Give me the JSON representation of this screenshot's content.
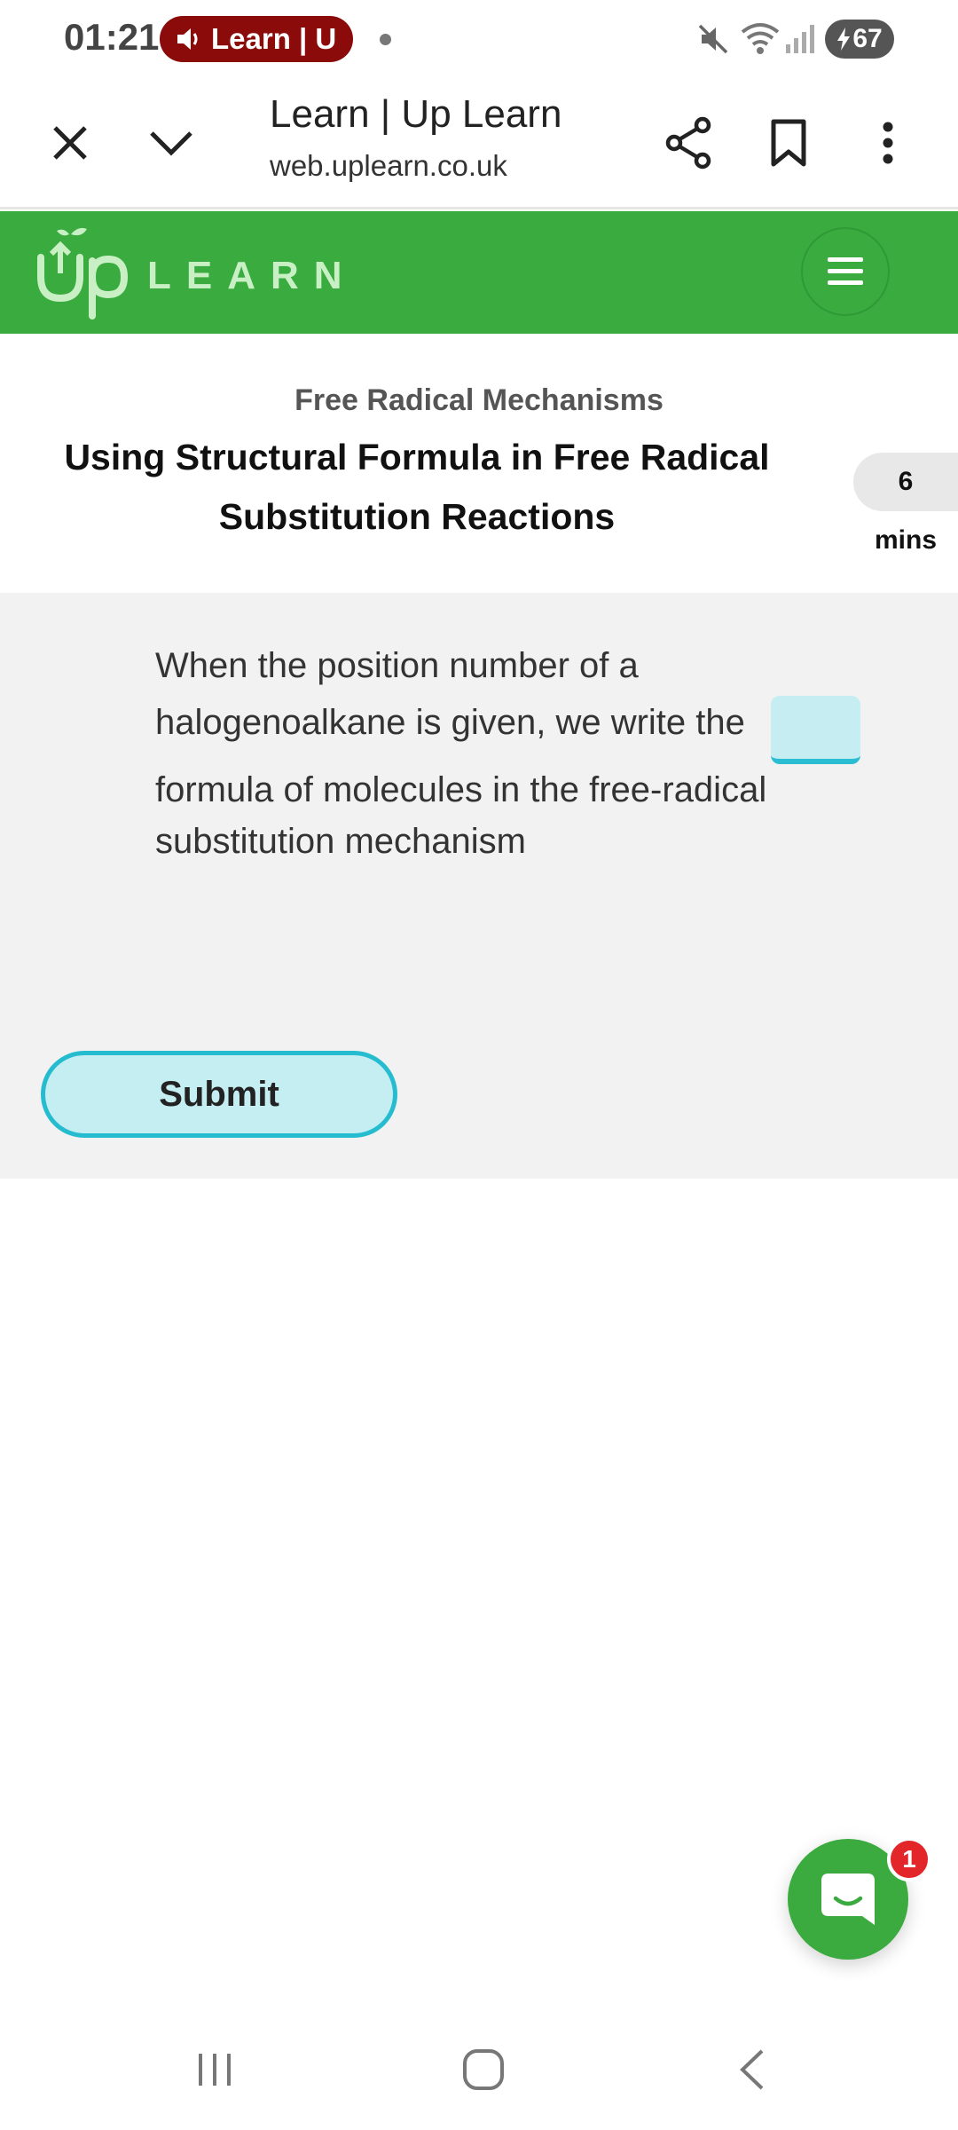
{
  "status_bar": {
    "time": "01:21",
    "media_label": "Learn | U",
    "battery": "67"
  },
  "browser": {
    "title": "Learn | Up Learn",
    "url": "web.uplearn.co.uk"
  },
  "site_header": {
    "logo_text": "Up LEARN",
    "logo_word": "LEARN",
    "brand_color": "#39ab3f"
  },
  "lesson": {
    "section": "Free Radical Mechanisms",
    "title": "Using Structural Formula in Free Radical Substitution Reactions",
    "time_value": "6",
    "time_unit": "mins"
  },
  "question": {
    "line1": "When the position number of a",
    "line2": "halogenoalkane is given, we write the",
    "line3": "formula of molecules in the free-radical",
    "line4": "substitution mechanism",
    "blank_value": ""
  },
  "actions": {
    "submit_label": "Submit"
  },
  "chat": {
    "badge_count": "1"
  },
  "icons": {
    "close": "close-icon",
    "expand": "chevron-down-icon",
    "share": "share-icon",
    "bookmark": "bookmark-icon",
    "more": "more-vert-icon",
    "menu": "hamburger-icon",
    "chat": "chat-icon"
  }
}
